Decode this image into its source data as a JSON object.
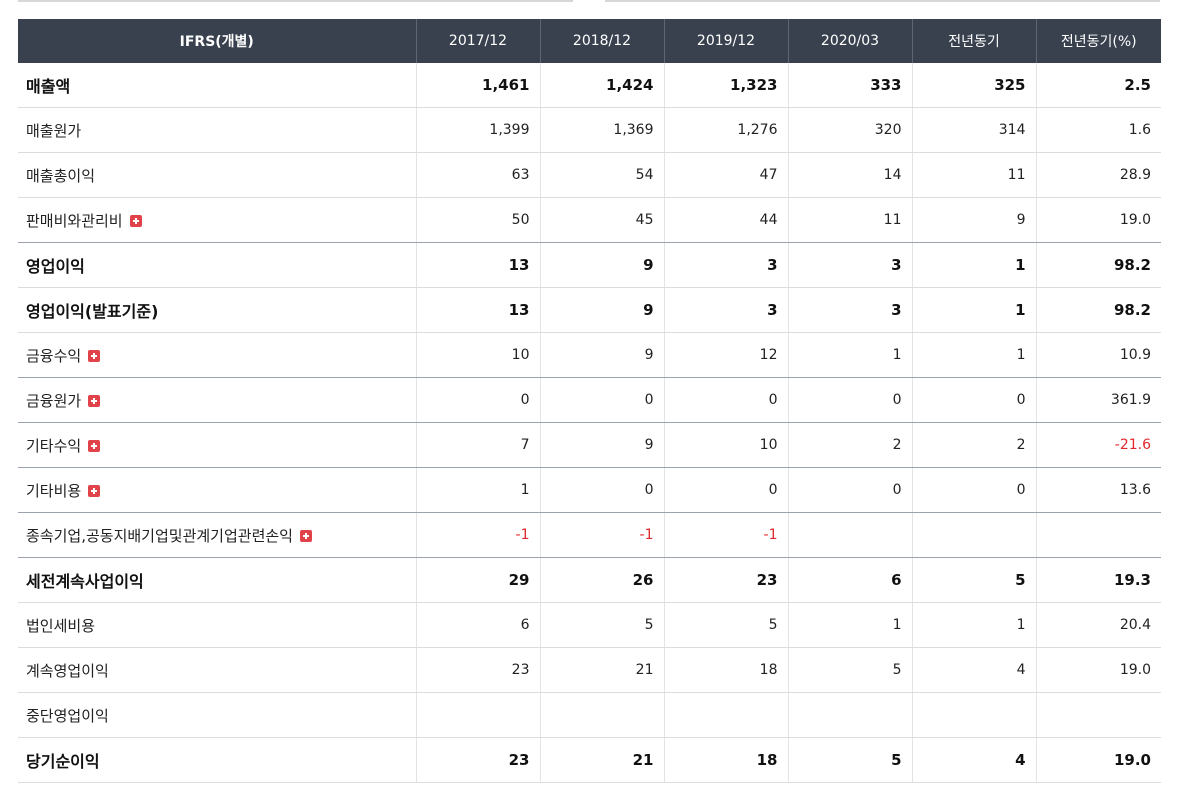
{
  "table": {
    "headers": [
      "IFRS(개별)",
      "2017/12",
      "2018/12",
      "2019/12",
      "2020/03",
      "전년동기",
      "전년동기(%)"
    ],
    "rows": [
      {
        "label": "매출액",
        "values": [
          "1,461",
          "1,424",
          "1,323",
          "333",
          "325",
          "2.5"
        ],
        "bold": true,
        "expand": false,
        "sep": false
      },
      {
        "label": "매출원가",
        "values": [
          "1,399",
          "1,369",
          "1,276",
          "320",
          "314",
          "1.6"
        ],
        "bold": false,
        "expand": false,
        "sep": false
      },
      {
        "label": "매출총이익",
        "values": [
          "63",
          "54",
          "47",
          "14",
          "11",
          "28.9"
        ],
        "bold": false,
        "expand": false,
        "sep": false
      },
      {
        "label": "판매비와관리비",
        "values": [
          "50",
          "45",
          "44",
          "11",
          "9",
          "19.0"
        ],
        "bold": false,
        "expand": true,
        "sep": true
      },
      {
        "label": "영업이익",
        "values": [
          "13",
          "9",
          "3",
          "3",
          "1",
          "98.2"
        ],
        "bold": true,
        "expand": false,
        "sep": false
      },
      {
        "label": "영업이익(발표기준)",
        "values": [
          "13",
          "9",
          "3",
          "3",
          "1",
          "98.2"
        ],
        "bold": true,
        "expand": false,
        "sep": false
      },
      {
        "label": "금융수익",
        "values": [
          "10",
          "9",
          "12",
          "1",
          "1",
          "10.9"
        ],
        "bold": false,
        "expand": true,
        "sep": true
      },
      {
        "label": "금융원가",
        "values": [
          "0",
          "0",
          "0",
          "0",
          "0",
          "361.9"
        ],
        "bold": false,
        "expand": true,
        "sep": true
      },
      {
        "label": "기타수익",
        "values": [
          "7",
          "9",
          "10",
          "2",
          "2",
          "-21.6"
        ],
        "bold": false,
        "expand": true,
        "sep": true
      },
      {
        "label": "기타비용",
        "values": [
          "1",
          "0",
          "0",
          "0",
          "0",
          "13.6"
        ],
        "bold": false,
        "expand": true,
        "sep": true
      },
      {
        "label": "종속기업,공동지배기업및관계기업관련손익",
        "values": [
          "-1",
          "-1",
          "-1",
          "",
          "",
          ""
        ],
        "bold": false,
        "expand": true,
        "sep": true
      },
      {
        "label": "세전계속사업이익",
        "values": [
          "29",
          "26",
          "23",
          "6",
          "5",
          "19.3"
        ],
        "bold": true,
        "expand": false,
        "sep": false
      },
      {
        "label": "법인세비용",
        "values": [
          "6",
          "5",
          "5",
          "1",
          "1",
          "20.4"
        ],
        "bold": false,
        "expand": false,
        "sep": false
      },
      {
        "label": "계속영업이익",
        "values": [
          "23",
          "21",
          "18",
          "5",
          "4",
          "19.0"
        ],
        "bold": false,
        "expand": false,
        "sep": false
      },
      {
        "label": "중단영업이익",
        "values": [
          "",
          "",
          "",
          "",
          "",
          ""
        ],
        "bold": false,
        "expand": false,
        "sep": false
      },
      {
        "label": "당기순이익",
        "values": [
          "23",
          "21",
          "18",
          "5",
          "4",
          "19.0"
        ],
        "bold": true,
        "expand": false,
        "sep": false
      }
    ]
  },
  "icons": {
    "expand": "plus-square-icon"
  },
  "colors": {
    "header_bg": "#39414f",
    "negative": "#e0282c",
    "expand_icon": "#e0434a"
  }
}
